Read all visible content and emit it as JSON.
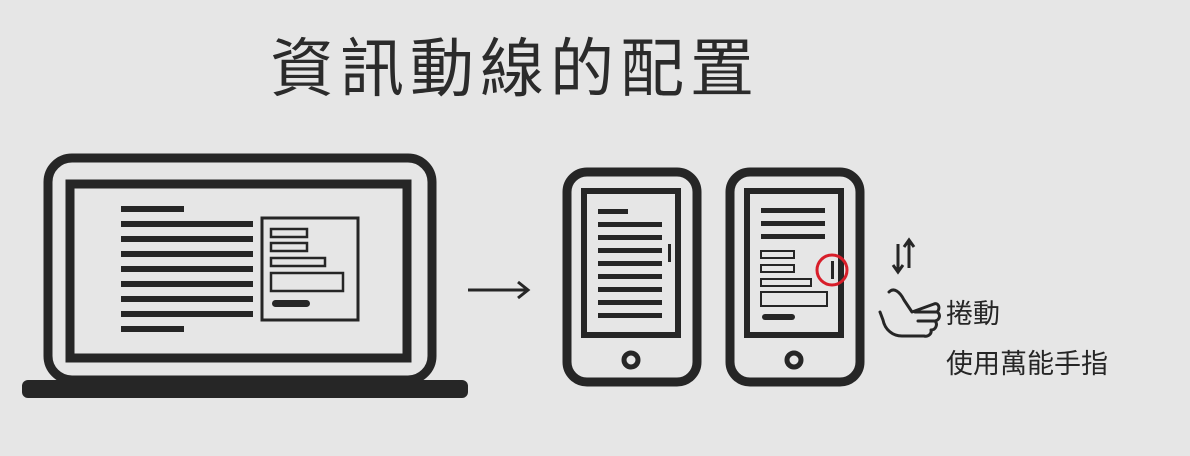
{
  "title": "資訊動線的配置",
  "captions": {
    "scroll": "捲動",
    "finger": "使用萬能手指"
  },
  "colors": {
    "background": "#e6e6e6",
    "ink": "#262626",
    "highlight": "#d81e2a"
  },
  "icons": [
    "laptop-icon",
    "arrow-right-icon",
    "tablet-icon",
    "tablet-icon",
    "scroll-arrows-icon",
    "pointing-hand-icon"
  ]
}
